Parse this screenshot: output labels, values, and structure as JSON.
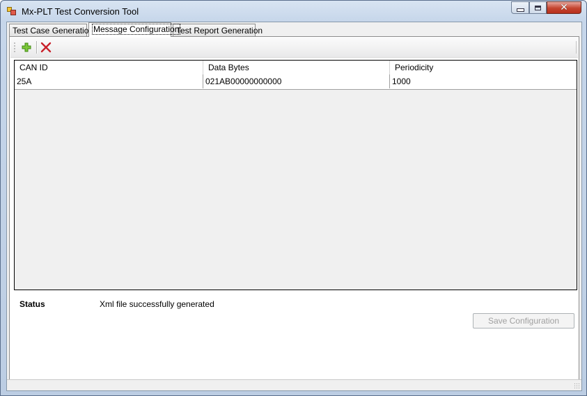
{
  "window": {
    "title": "Mx-PLT Test Conversion Tool",
    "controls": {
      "minimize": "minimize-icon",
      "maximize": "maximize-icon",
      "close": "✕"
    }
  },
  "tabs": [
    {
      "label": "Test Case Generation",
      "active": false
    },
    {
      "label": "Message Configuration",
      "active": true
    },
    {
      "label": "Test Report Generation",
      "active": false
    }
  ],
  "toolbar": {
    "add_icon": "add-plus-icon",
    "delete_icon": "delete-x-icon",
    "colors": {
      "add": "#5aa800",
      "delete": "#c8202a"
    }
  },
  "grid": {
    "columns": [
      "CAN ID",
      "Data Bytes",
      "Periodicity"
    ],
    "rows": [
      {
        "can_id": "25A",
        "data_bytes": "021AB00000000000",
        "periodicity": "1000"
      }
    ]
  },
  "status": {
    "label": "Status",
    "message": "Xml file successfully generated"
  },
  "actions": {
    "save_label": "Save Configuration",
    "save_enabled": false
  }
}
